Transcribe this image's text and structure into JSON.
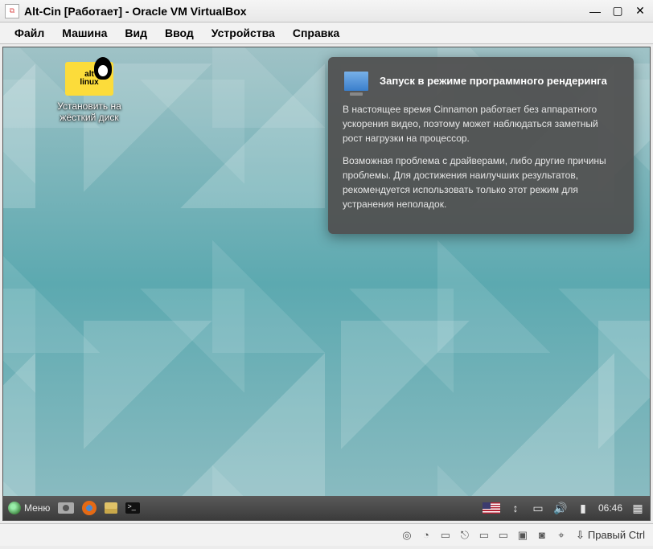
{
  "window": {
    "title": "Alt-Cin [Работает] - Oracle VM VirtualBox",
    "minimize_glyph": "—",
    "maximize_glyph": "▢",
    "close_glyph": "✕"
  },
  "menubar": [
    "Файл",
    "Машина",
    "Вид",
    "Ввод",
    "Устройства",
    "Справка"
  ],
  "desktop_icon": {
    "logo_line1": "alt",
    "logo_line2": "linux",
    "label": "Установить на жёсткий диск"
  },
  "notification": {
    "title": "Запуск в режиме программного рендеринга",
    "body1": "В настоящее время Cinnamon работает без аппаратного ускорения видео, поэтому может наблюдаться заметный рост нагрузки на процессор.",
    "body2": "Возможная проблема с драйверами, либо другие причины проблемы. Для достижения наилучших результатов, рекомендуется использовать только этот режим для устранения неполадок."
  },
  "taskbar": {
    "menu_label": "Меню",
    "clock": "06:46",
    "net_glyph": "↕",
    "disk_glyph": "▭",
    "sound_glyph": "🔊",
    "battery_glyph": "▮"
  },
  "statusbar": {
    "cd_glyph": "◎",
    "hdd_glyph": "◔",
    "net_glyph": "▭",
    "usb_glyph": "⎋",
    "folder_glyph": "▭",
    "monitor_glyph": "▭",
    "display_glyph": "▣",
    "rec_glyph": "◙",
    "mouse_glyph": "⌖",
    "hostkey_arrow": "⇩",
    "hostkey_label": "Правый Ctrl"
  }
}
